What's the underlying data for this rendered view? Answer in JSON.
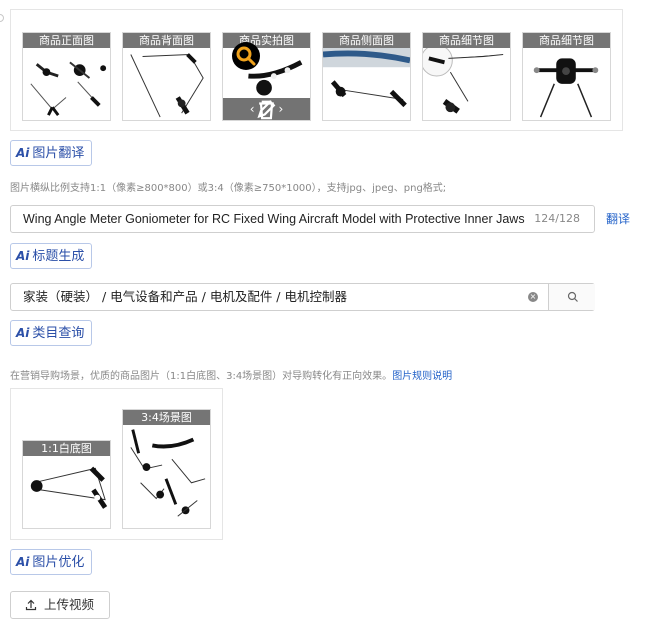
{
  "gallery": {
    "images": [
      {
        "label": "商品正面图"
      },
      {
        "label": "商品背面图"
      },
      {
        "label": "商品实拍图"
      },
      {
        "label": "商品侧面图"
      },
      {
        "label": "商品细节图"
      },
      {
        "label": "商品细节图"
      }
    ],
    "hovered_overlay": {
      "prev": "‹",
      "next": "›"
    }
  },
  "image_translate_button": {
    "ai_mark": "Ai",
    "label": "图片翻译"
  },
  "image_hint": "图片横纵比例支持1:1（像素≥800*800）或3:4（像素≥750*1000），支持jpg、jpeg、png格式;",
  "title_field": {
    "value": "Wing Angle Meter Goniometer for RC Fixed Wing Aircraft Model with Protective Inner Jaws",
    "counter": "124/128",
    "translate_label": "翻译"
  },
  "title_generate_button": {
    "ai_mark": "Ai",
    "label": "标题生成"
  },
  "category_field": {
    "value": "家装（硬装） / 电气设备和产品 / 电机及配件 / 电机控制器",
    "clear_symbol": "×"
  },
  "category_query_button": {
    "ai_mark": "Ai",
    "label": "类目查询"
  },
  "marketing_hint": {
    "text": "在营销导购场景，优质的商品图片（1:1白底图、3:4场景图）对导购转化有正向效果。",
    "link": "图片规则说明"
  },
  "marketing_images": [
    {
      "label": "1:1白底图"
    },
    {
      "label": "3:4场景图"
    }
  ],
  "image_optimize_button": {
    "ai_mark": "Ai",
    "label": "图片优化"
  },
  "upload_video_button": {
    "label": "上传视频"
  }
}
